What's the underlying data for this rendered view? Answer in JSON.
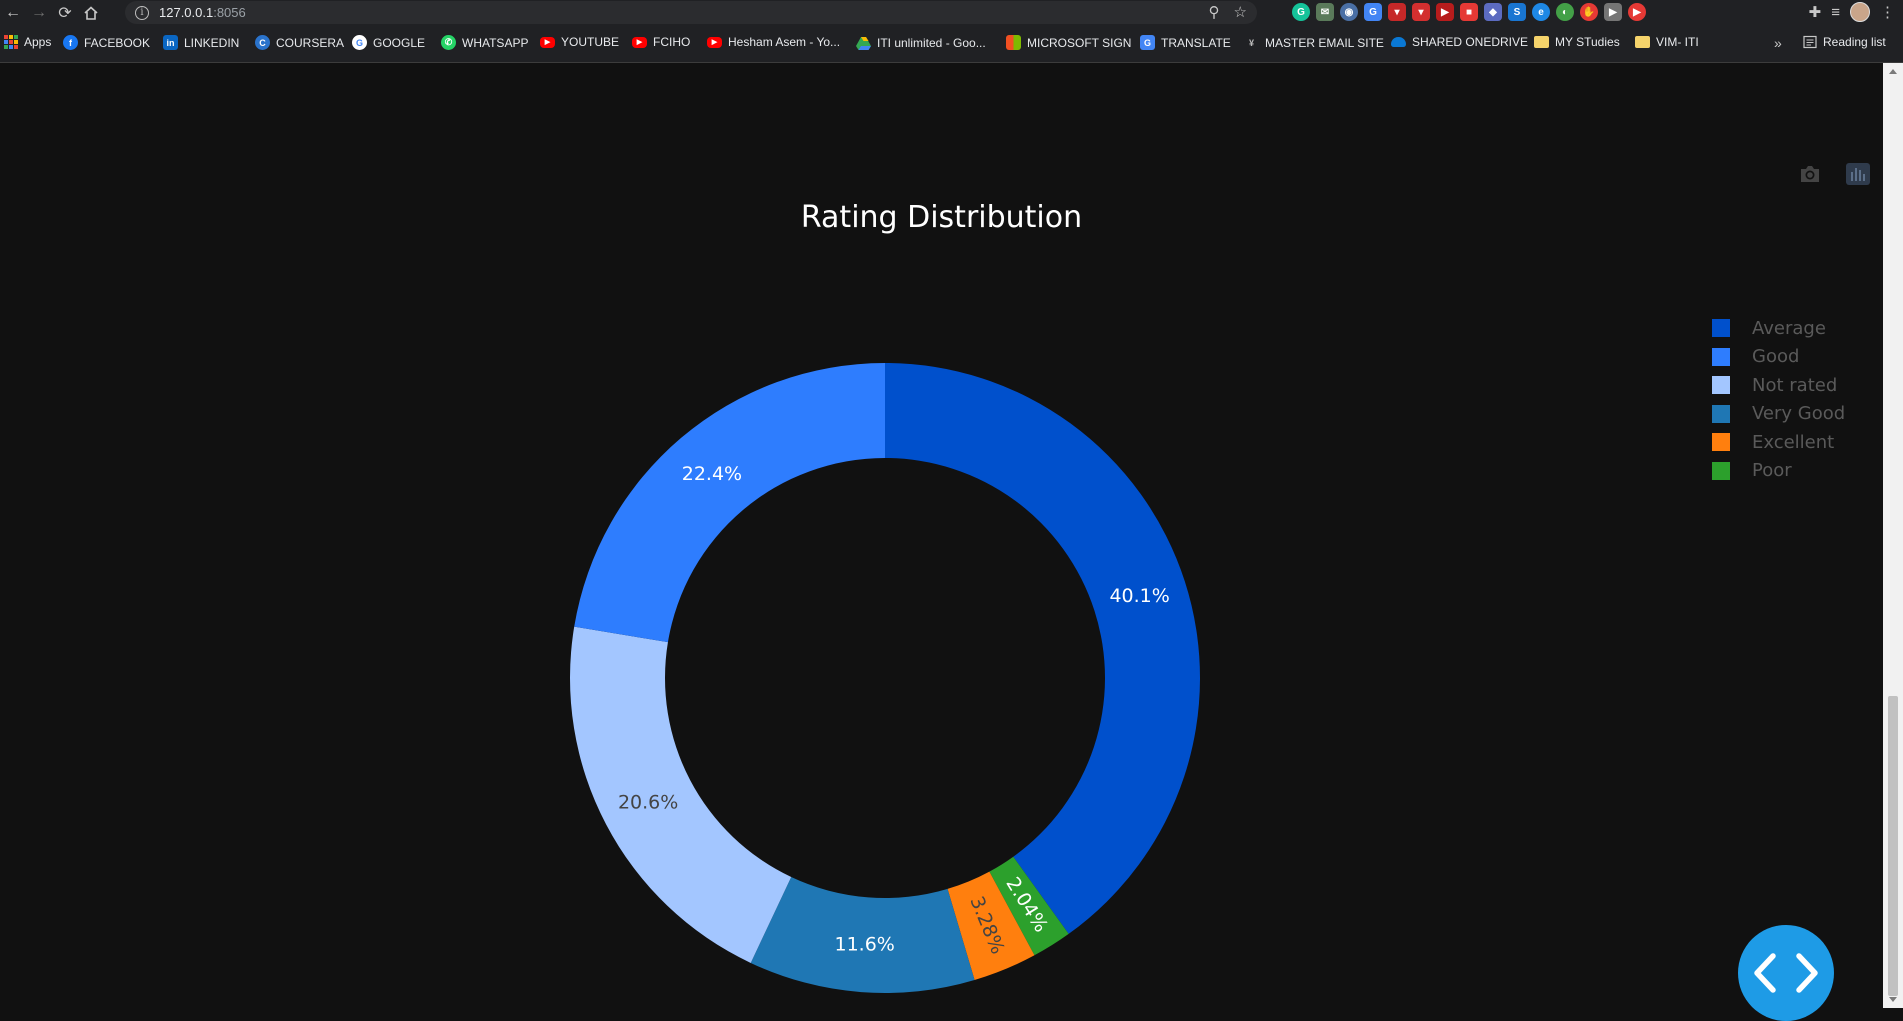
{
  "browser": {
    "url_host": "127.0.0.1",
    "url_port": ":8056",
    "extensions": [
      {
        "icon": "grammarly-icon",
        "text": "G",
        "color": "#15c39a",
        "round": true
      },
      {
        "icon": "mail-icon",
        "text": "✉",
        "color": "#5a7a5a",
        "round": false
      },
      {
        "icon": "compass-icon",
        "text": "◉",
        "color": "#4a6fa5",
        "round": true
      },
      {
        "icon": "translate-icon",
        "text": "G",
        "color": "#4285f4",
        "round": false
      },
      {
        "icon": "red-ext-icon",
        "text": "▾",
        "color": "#c62828",
        "round": false
      },
      {
        "icon": "pocket-icon",
        "text": "▾",
        "color": "#d32f2f",
        "round": false
      },
      {
        "icon": "red-square-icon",
        "text": "▶",
        "color": "#b71c1c",
        "round": false
      },
      {
        "icon": "record-icon",
        "text": "■",
        "color": "#e53935",
        "round": false
      },
      {
        "icon": "dropbox-icon",
        "text": "◆",
        "color": "#5c6bc0",
        "round": false
      },
      {
        "icon": "skype-icon",
        "text": "S",
        "color": "#1976d2",
        "round": false
      },
      {
        "icon": "edge-icon",
        "text": "e",
        "color": "#1e88e5",
        "round": true
      },
      {
        "icon": "leaf-icon",
        "text": "◐",
        "color": "#43a047",
        "round": true
      },
      {
        "icon": "hand-icon",
        "text": "✋",
        "color": "#e53935",
        "round": true
      },
      {
        "icon": "video-icon",
        "text": "▶",
        "color": "#757575",
        "round": false
      },
      {
        "icon": "youtube-ext-icon",
        "text": "▶",
        "color": "#e53935",
        "round": true
      }
    ]
  },
  "bookmarks": [
    {
      "label": "Apps",
      "icon": "apps-icon",
      "color": "#4285f4"
    },
    {
      "label": "FACEBOOK",
      "icon": "facebook-icon",
      "color": "#1877f2"
    },
    {
      "label": "LINKEDIN",
      "icon": "linkedin-icon",
      "color": "#0a66c2"
    },
    {
      "label": "COURSERA",
      "icon": "coursera-icon",
      "color": "#2a73cc"
    },
    {
      "label": "GOOGLE",
      "icon": "google-icon",
      "color": "#ffffff"
    },
    {
      "label": "WHATSAPP",
      "icon": "whatsapp-icon",
      "color": "#25d366"
    },
    {
      "label": "YOUTUBE",
      "icon": "youtube-icon",
      "color": "#ff0000"
    },
    {
      "label": "FCIHO",
      "icon": "youtube-icon",
      "color": "#ff0000"
    },
    {
      "label": "Hesham Asem - Yo...",
      "icon": "youtube-icon",
      "color": "#ff0000"
    },
    {
      "label": "ITI unlimited - Goo...",
      "icon": "google-drive-icon",
      "color": "#fbbc04"
    },
    {
      "label": "MICROSOFT SIGN",
      "icon": "microsoft-icon",
      "color": "#f25022"
    },
    {
      "label": "TRANSLATE",
      "icon": "translate-icon",
      "color": "#4285f4"
    },
    {
      "label": "MASTER EMAIL SITE",
      "icon": "email-site-icon",
      "color": "#3a3a3a"
    },
    {
      "label": "SHARED ONEDRIVE",
      "icon": "onedrive-icon",
      "color": "#0a78d4"
    },
    {
      "label": "MY STudies",
      "icon": "folder-icon",
      "color": "#f5d36b"
    },
    {
      "label": "VIM- ITI",
      "icon": "folder-icon",
      "color": "#f5d36b"
    }
  ],
  "bookmarks_overflow": "»",
  "reading_list": "Reading list",
  "chart_data": {
    "type": "pie",
    "hole": true,
    "title": "Rating Distribution",
    "labels": [
      "Average",
      "Good",
      "Not rated",
      "Very Good",
      "Excellent",
      "Poor"
    ],
    "values": [
      40.1,
      22.4,
      20.6,
      11.6,
      3.28,
      2.04
    ],
    "text_labels": [
      "40.1%",
      "22.4%",
      "20.6%",
      "11.6%",
      "3.28%",
      "2.04%"
    ],
    "colors": [
      "#0050cc",
      "#2e7dfe",
      "#a3c6ff",
      "#1f77b4",
      "#ff7f0e",
      "#2ca02c"
    ],
    "drawing_order": [
      "Average",
      "Poor",
      "Excellent",
      "Very Good",
      "Not rated",
      "Good"
    ],
    "direction": "clockwise",
    "legend_position": "right"
  }
}
